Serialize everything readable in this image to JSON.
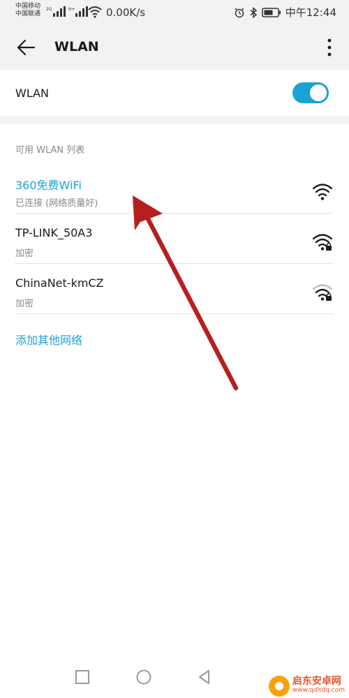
{
  "status": {
    "carrier1": "中国移动",
    "carrier2": "中国联通",
    "net1": "2G",
    "net2": "H+",
    "speed": "0.00K/s",
    "time": "中午12:44"
  },
  "appbar": {
    "title": "WLAN"
  },
  "wlan_switch": {
    "label": "WLAN",
    "on": true
  },
  "section_title": "可用 WLAN 列表",
  "networks": [
    {
      "name": "360免费WiFi",
      "status": "已连接 (网络质量好)",
      "connected": true,
      "secured": false,
      "signal": "full"
    },
    {
      "name": "TP-LINK_50A3",
      "status": "加密",
      "connected": false,
      "secured": true,
      "signal": "full"
    },
    {
      "name": "ChinaNet-kmCZ",
      "status": "加密",
      "connected": false,
      "secured": true,
      "signal": "medium"
    }
  ],
  "add_network": "添加其他网络",
  "watermark": {
    "title": "启东安卓网",
    "url": "www.qdltdq.com"
  },
  "colors": {
    "accent": "#1aa3d6",
    "arrow": "#b5201f"
  }
}
